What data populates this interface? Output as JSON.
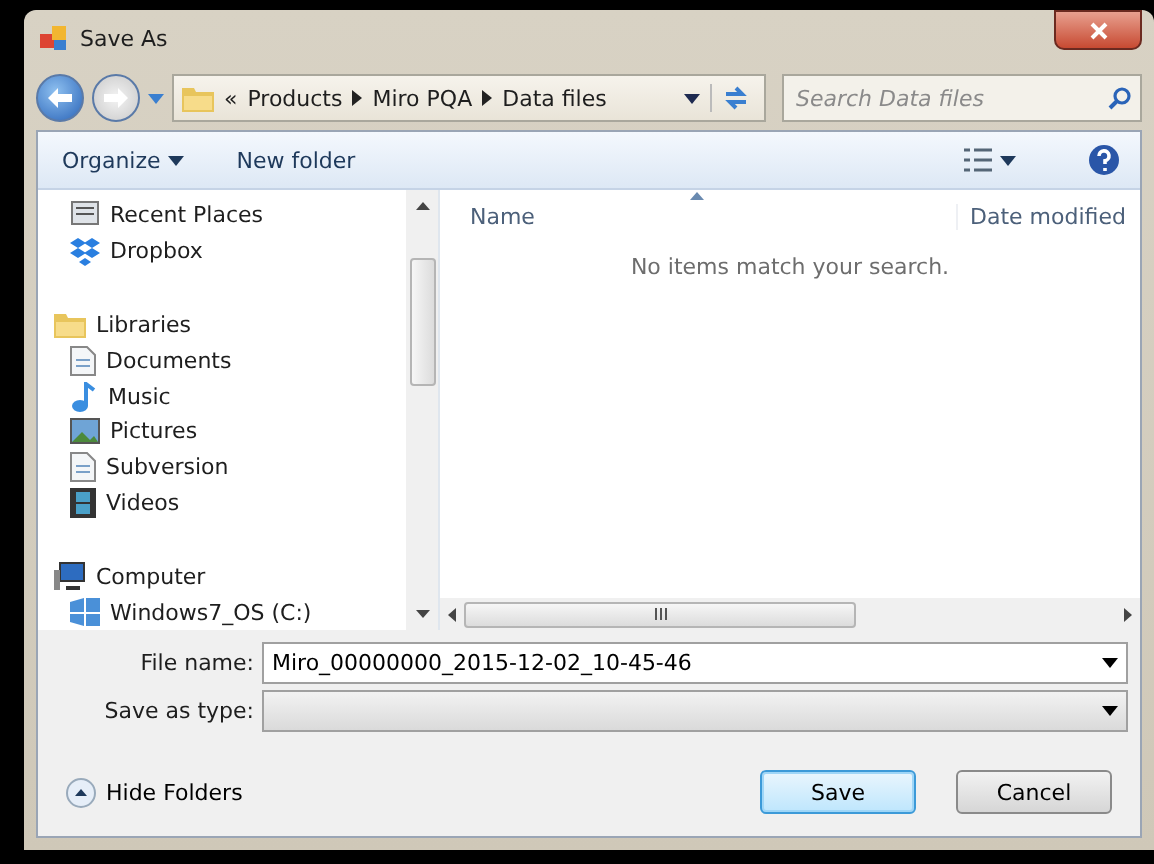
{
  "window": {
    "title": "Save As"
  },
  "breadcrumb": {
    "overflow": "«",
    "segments": [
      "Products",
      "Miro PQA",
      "Data files"
    ]
  },
  "search": {
    "placeholder": "Search Data files"
  },
  "toolbar": {
    "organize": "Organize",
    "new_folder": "New folder"
  },
  "nav_tree": [
    {
      "children": [
        {
          "label": "Recent Places"
        },
        {
          "label": "Dropbox"
        }
      ]
    },
    {
      "label": "Libraries",
      "children": [
        {
          "label": "Documents"
        },
        {
          "label": "Music"
        },
        {
          "label": "Pictures"
        },
        {
          "label": "Subversion"
        },
        {
          "label": "Videos"
        }
      ]
    },
    {
      "label": "Computer",
      "children": [
        {
          "label": "Windows7_OS (C:)"
        }
      ]
    }
  ],
  "file_list": {
    "columns": [
      "Name",
      "Date modified"
    ],
    "empty_message": "No items match your search."
  },
  "file_name": {
    "label": "File name:",
    "value": "Miro_00000000_2015-12-02_10-45-46"
  },
  "save_as_type": {
    "label": "Save as type:"
  },
  "hide_folders": "Hide Folders",
  "buttons": [
    {
      "label": "Save",
      "default": true
    },
    {
      "label": "Cancel",
      "default": false
    }
  ]
}
